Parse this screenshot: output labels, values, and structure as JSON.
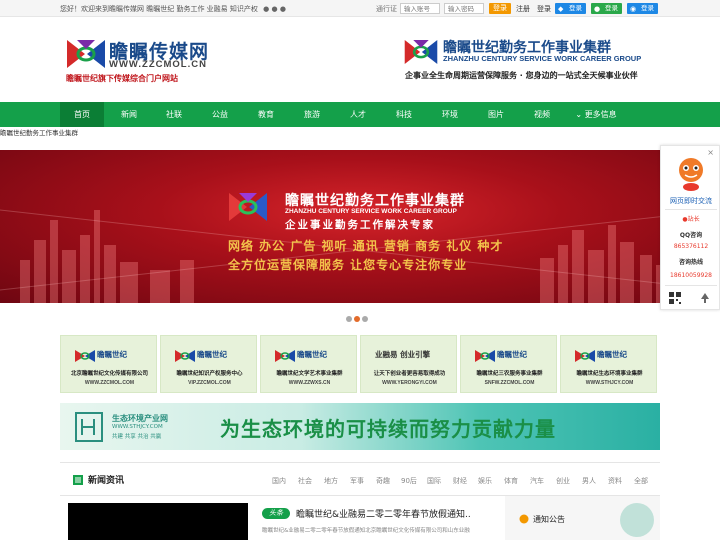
{
  "topbar": {
    "welcome": "您好！欢迎来到瞻瞩传媒网 瞻瞩世纪 勤务工作 业融易 知识产权",
    "login_label": "通行证",
    "account_placeholder": "输入账号",
    "password_placeholder": "输入密码",
    "login_button": "登录",
    "register": "注册",
    "login": "登录",
    "qq_login": "登录",
    "wechat_login": "登录",
    "weibo_login": "登录"
  },
  "header": {
    "left_name": "瞻瞩传媒网",
    "left_url": "WWW.ZZCMOL.CN",
    "left_sub": "瞻瞩世纪旗下传媒综合门户网站",
    "right_name": "瞻瞩世纪勤务工作事业集群",
    "right_en": "ZHANZHU CENTURY SERVICE WORK CAREER GROUP",
    "right_slogan": "企事业全生命周期运营保障服务 · 您身边的一站式全天候事业伙伴"
  },
  "nav": {
    "items": [
      "首页",
      "新闻",
      "社联",
      "公益",
      "教育",
      "旅游",
      "人才",
      "科技",
      "环境",
      "图片",
      "视频",
      "更多信息"
    ]
  },
  "breadcrumb": "瞻瞩世纪勤务工作事业集群",
  "banner": {
    "title": "瞻瞩世纪勤务工作事业集群",
    "en": "ZHANZHU CENTURY SERVICE WORK CAREER GROUP",
    "slogan": "企业事业勤务工作解决专家",
    "line1": "网络 办公 广告 视听 通讯 营销 商务 礼仪 种才",
    "line2": "全方位运营保障服务  让您专心专注你专业"
  },
  "cards": [
    {
      "title": "瞻瞩世纪",
      "sub": "北京瞻瞩世纪文化传媒有限公司",
      "url": "WWW.ZZCMOL.COM"
    },
    {
      "title": "瞻瞩世纪",
      "sub": "瞻瞩世纪知识产权服务中心",
      "url": "VIP.ZZCMOL.COM"
    },
    {
      "title": "瞻瞩世纪",
      "sub": "瞻瞩世纪文学艺术事业集群",
      "url": "WWW.ZZWXS.CN"
    },
    {
      "title": "业融易 创业引擎",
      "sub": "让天下创业者更容易取得成功",
      "url": "WWW.YERONGYI.COM"
    },
    {
      "title": "瞻瞩世纪",
      "sub": "瞻瞩世纪三农服务事业集群",
      "url": "SNFW.ZZCMOL.COM"
    },
    {
      "title": "瞻瞩世纪",
      "sub": "瞻瞩世纪生态环境事业集群",
      "url": "WWW.STHJCY.COM"
    }
  ],
  "eco": {
    "name": "生态环境产业网",
    "url": "WWW.STHJCY.COM",
    "sub": "共建 共享 共治 共赢",
    "slogan": "为生态环境的可持续而努力贡献力量"
  },
  "news": {
    "title": "新闻资讯",
    "tabs": [
      "国内",
      "社会",
      "地方",
      "军事",
      "奇趣",
      "90后",
      "国际",
      "财经",
      "娱乐",
      "体育",
      "汽车",
      "创业",
      "男人",
      "资料",
      "全部"
    ],
    "headline_tag": "头条",
    "headline": "瞻瞩世纪&业融易二零二零年春节放假通知..",
    "headline_desc": "瞻瞩世纪&业融易二零二零年春节放假通知北京瞻瞩世纪文化传媒有限公司和山东业融",
    "notice_title": "通知公告"
  },
  "side": {
    "chat": "网页即时交流",
    "station": "站长",
    "qq_label": "QQ咨询",
    "qq": "865376112",
    "hotline_label": "咨询热线",
    "hotline": "18610059928"
  },
  "colors": {
    "nav_green": "#14a04a",
    "banner_red": "#b8121c",
    "accent_orange": "#f39800"
  }
}
